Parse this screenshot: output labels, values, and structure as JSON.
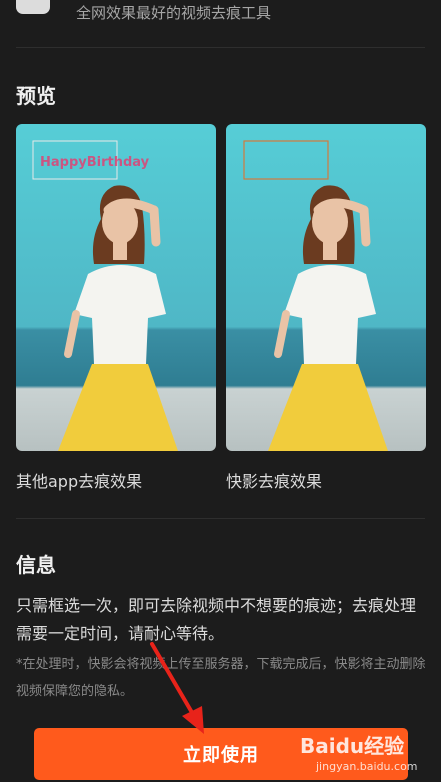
{
  "header": {
    "subtitle": "全网效果最好的视频去痕工具",
    "icon": "tool-icon"
  },
  "preview": {
    "title": "预览",
    "left": {
      "caption": "其他app去痕效果",
      "blurred_logo_text": "HappyBirthday"
    },
    "right": {
      "caption": "快影去痕效果"
    }
  },
  "info": {
    "title": "信息",
    "body": "只需框选一次，即可去除视频中不想要的痕迹；去痕处理需要一定时间，请耐心等待。",
    "note": "*在处理时，快影会将视频上传至服务器，下载完成后，快影将主动删除视频保障您的隐私。"
  },
  "cta": {
    "label": "立即使用"
  },
  "watermark": {
    "logo": "Baidu经验",
    "sub": "jingyan.baidu.com"
  },
  "colors": {
    "background": "#1c1c1c",
    "accent": "#ff5a1c",
    "annotation": "#e8231a"
  }
}
